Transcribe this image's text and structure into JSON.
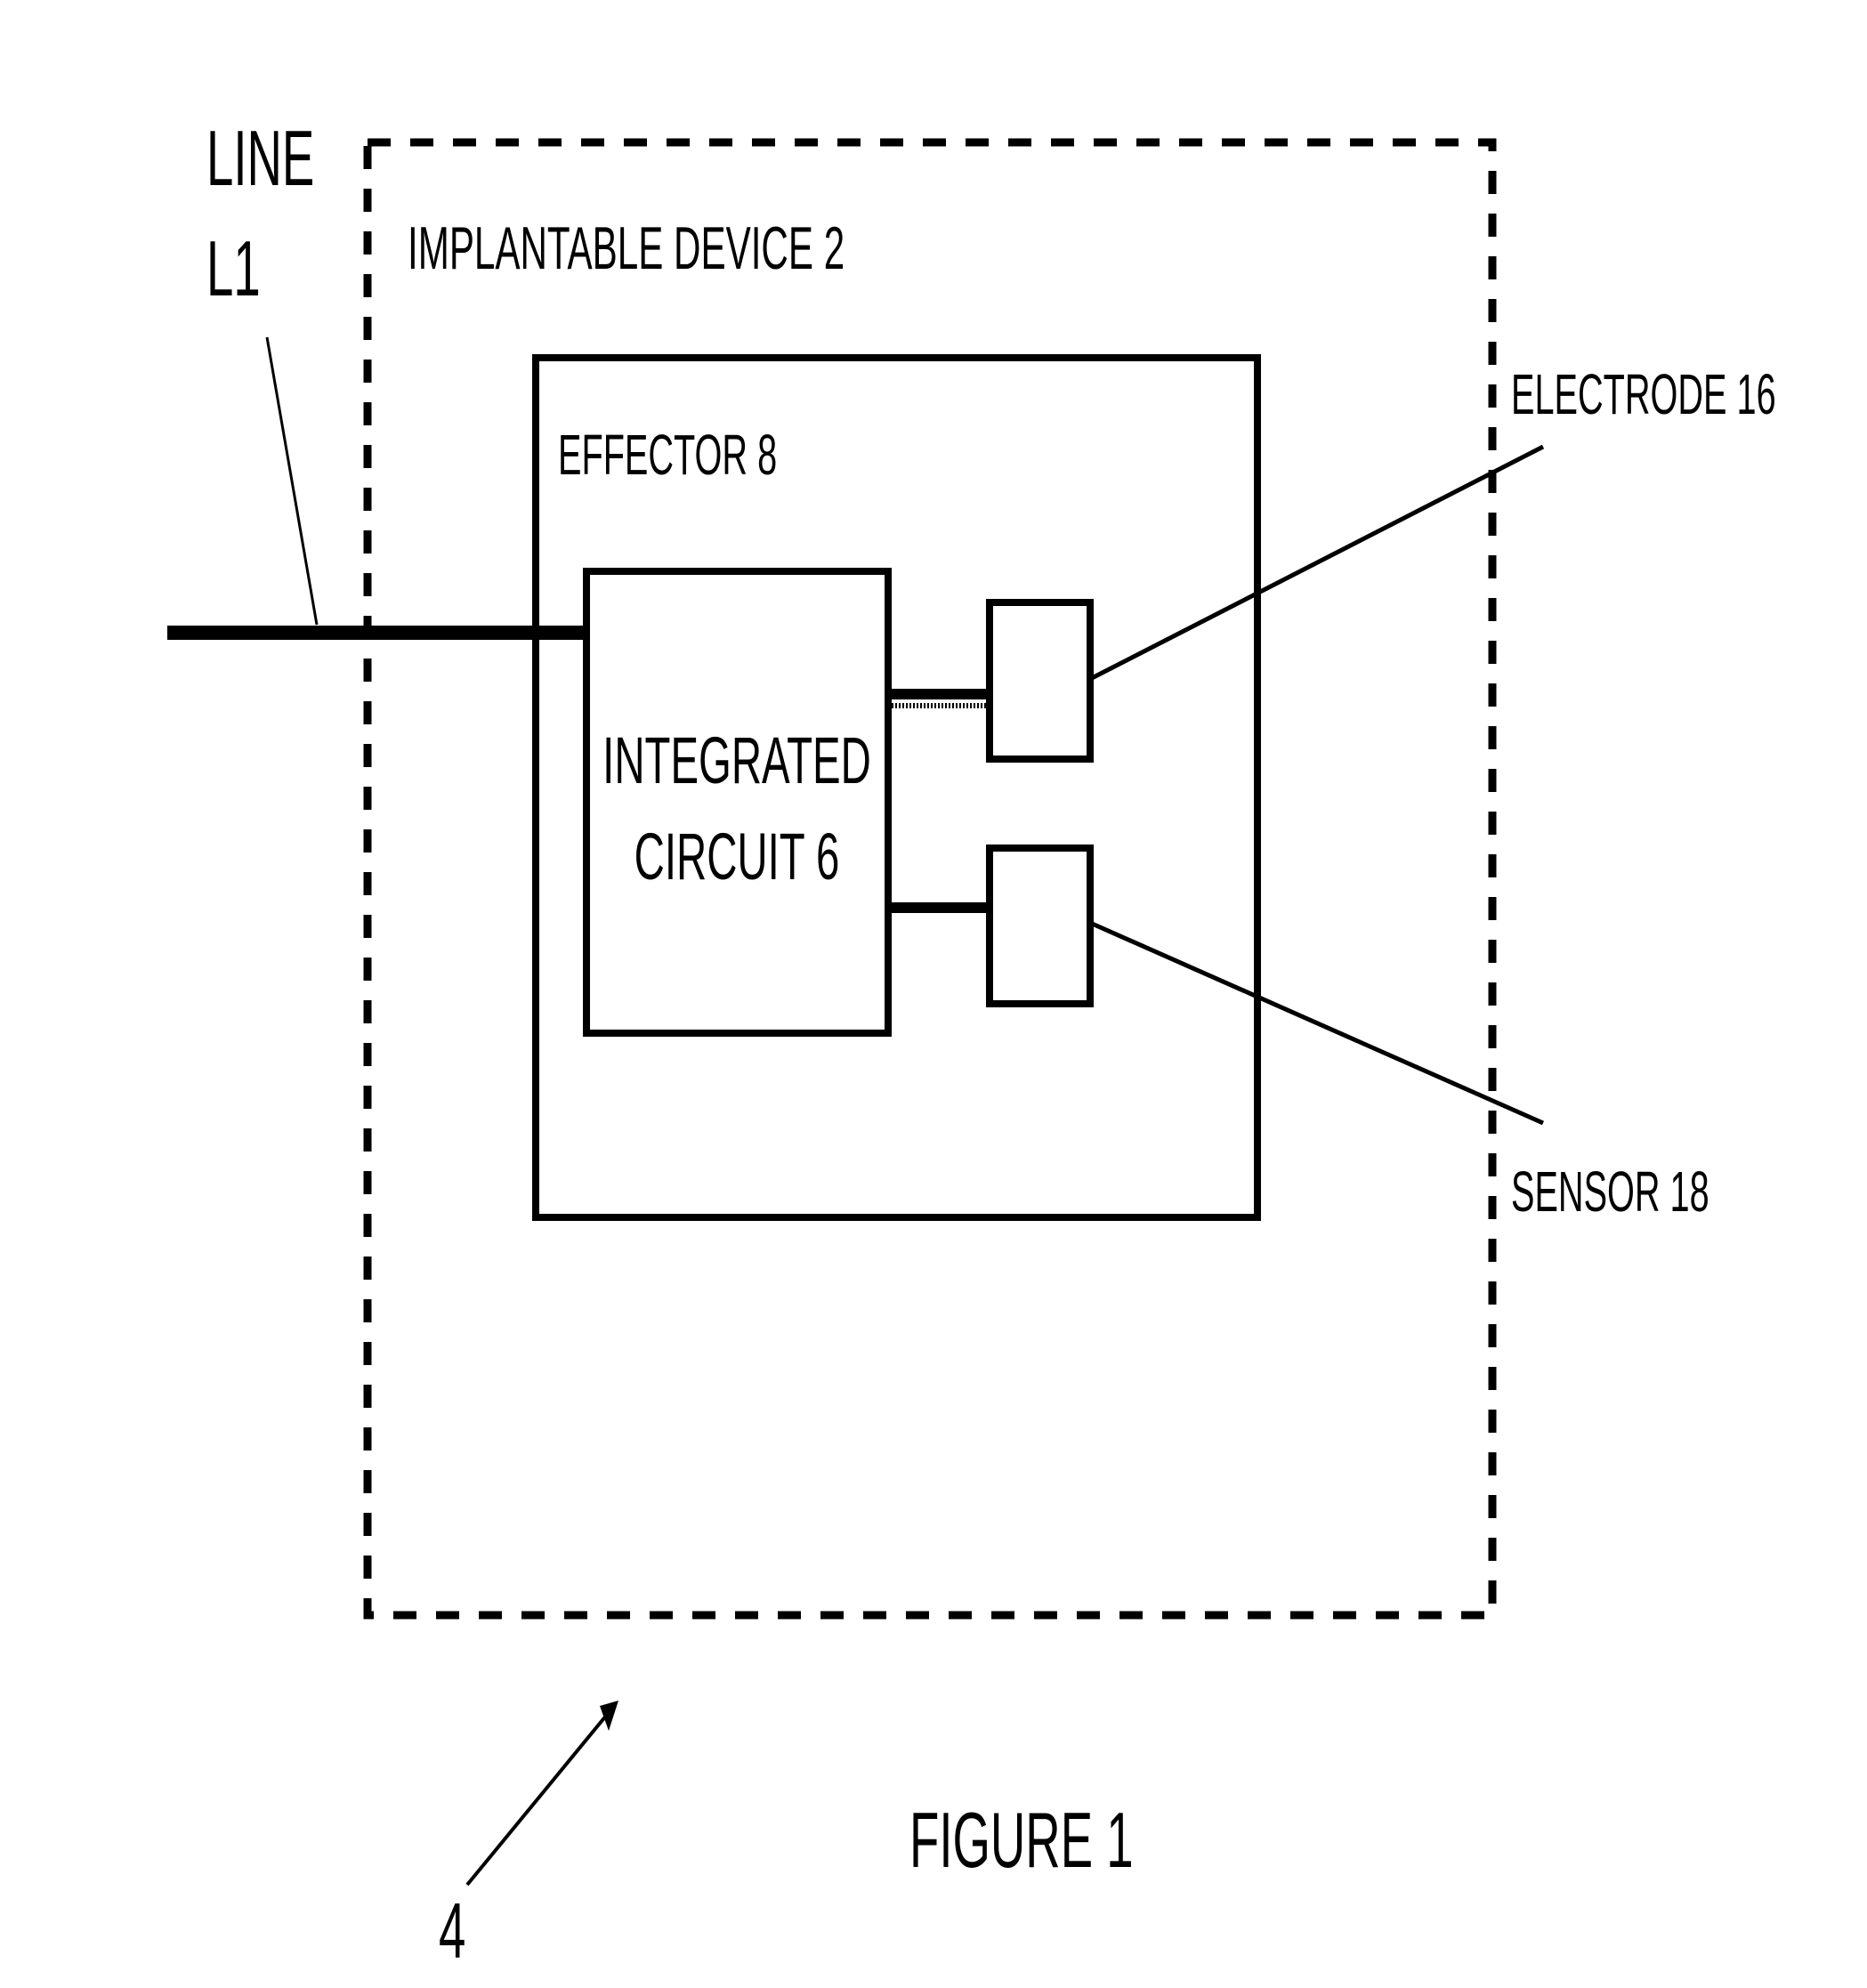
{
  "figure": {
    "title": "FIGURE 1",
    "reference_numeral": "4",
    "line_label": [
      "LINE",
      "L1"
    ],
    "device_label": "IMPLANTABLE DEVICE 2",
    "effector_label": "EFFECTOR 8",
    "ic_label": [
      "INTEGRATED",
      "CIRCUIT 6"
    ],
    "electrode_label": "ELECTRODE 16",
    "sensor_label": "SENSOR 18"
  },
  "colors": {
    "ink": "#000000",
    "paper": "#ffffff"
  }
}
